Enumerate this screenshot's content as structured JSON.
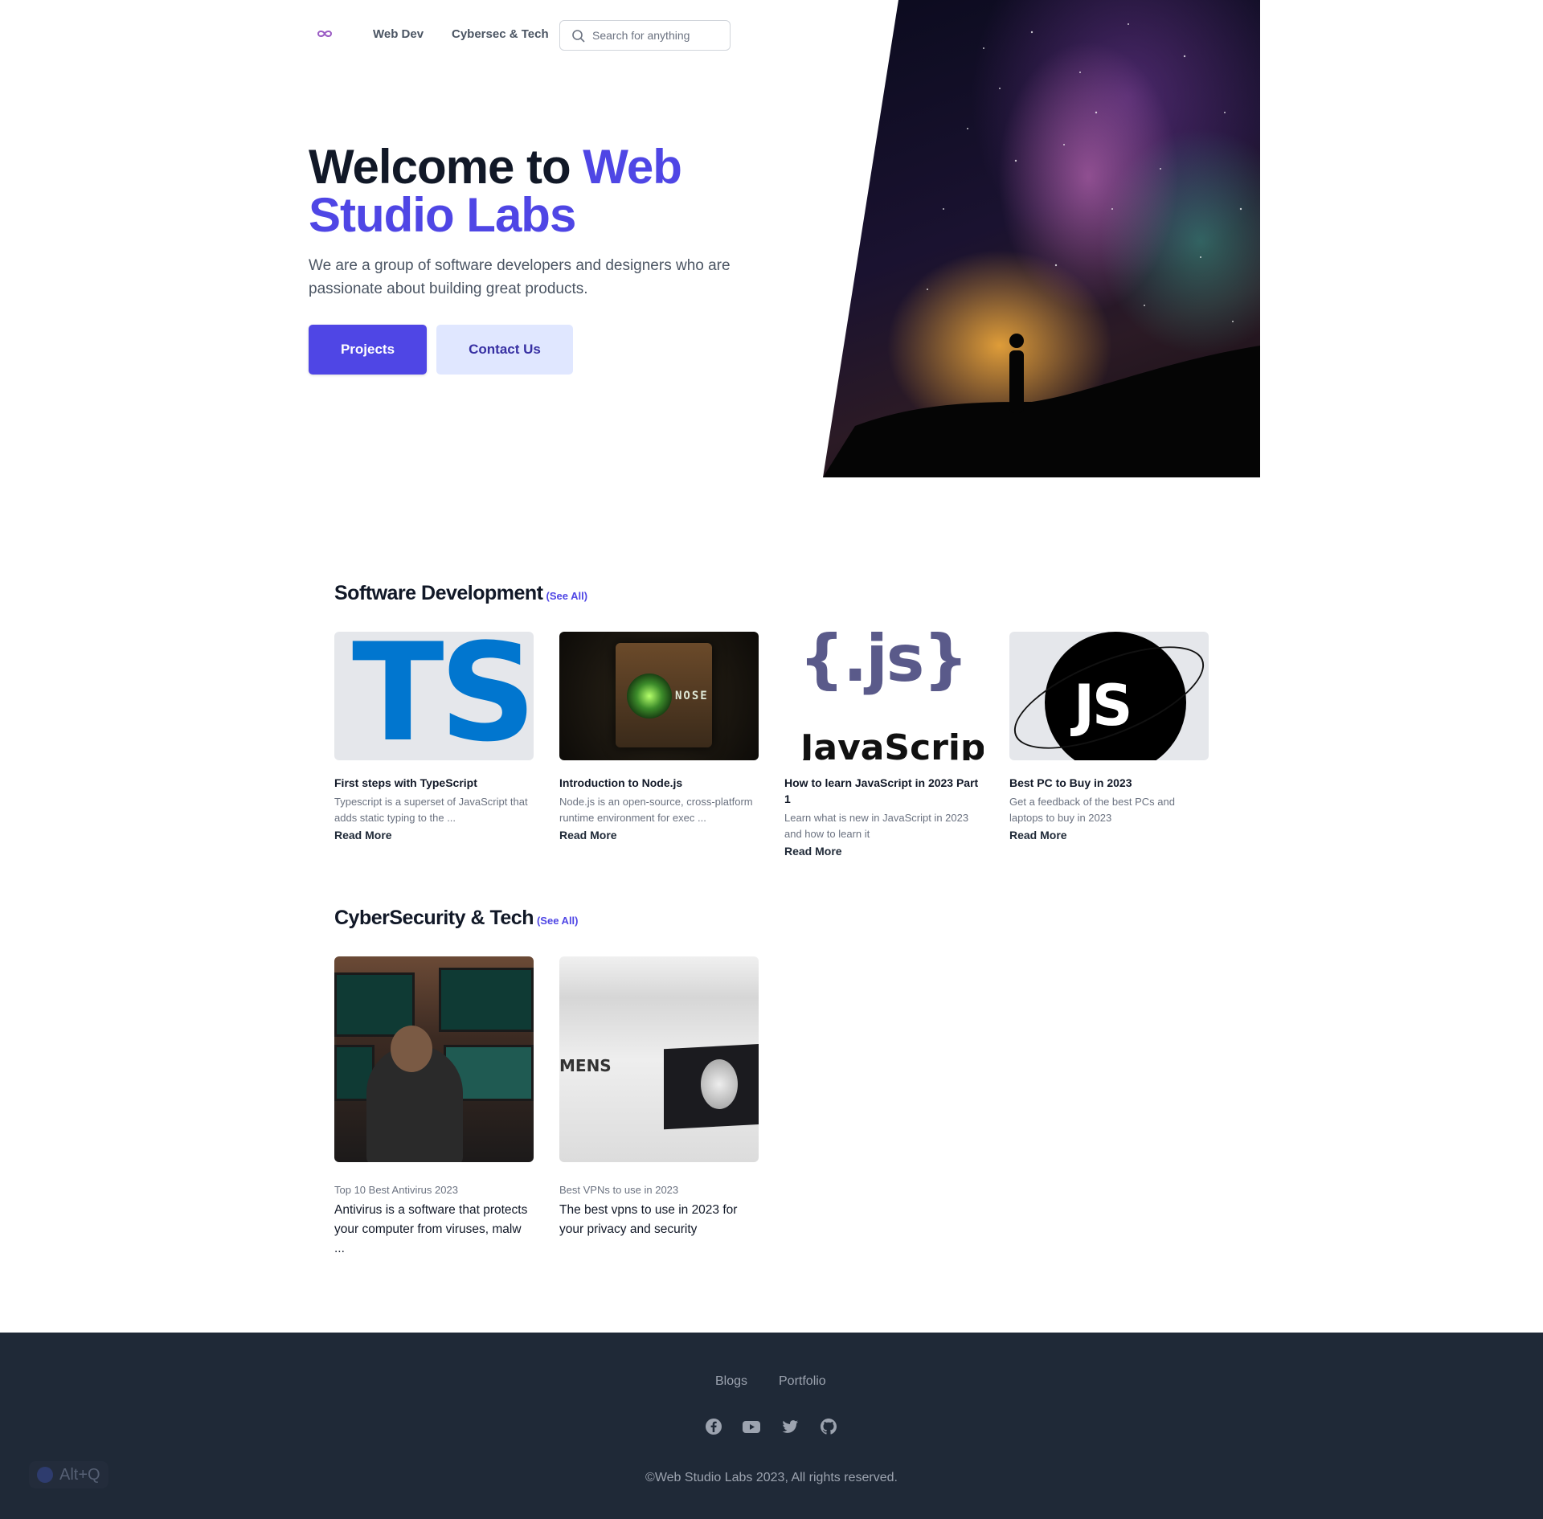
{
  "header": {
    "nav": [
      "Web Dev",
      "Cybersec & Tech"
    ],
    "search_placeholder": "Search for anything"
  },
  "hero": {
    "title_plain": "Welcome to ",
    "title_accent": "Web Studio Labs",
    "subtitle": "We are a group of software developers and designers who are passionate about building great products.",
    "primary_button": "Projects",
    "secondary_button": "Contact Us"
  },
  "sections": {
    "software": {
      "title": "Software Development",
      "see_all": "(See All)",
      "cards": [
        {
          "image_text": "TS",
          "title": "First steps with TypeScript",
          "description": "Typescript is a superset of JavaScript that adds static typing to the ...",
          "read_more": "Read More"
        },
        {
          "image_text": "NOSE",
          "title": "Introduction to Node.js",
          "description": "Node.js is an open-source, cross-platform runtime environment for exec ...",
          "read_more": "Read More"
        },
        {
          "image_text_1": "{.js}",
          "image_text_2": "JavaScript",
          "title": "How to learn JavaScript in 2023 Part 1",
          "description": "Learn what is new in JavaScript in 2023 and how to learn it",
          "read_more": "Read More"
        },
        {
          "image_text": "JS",
          "title": "Best PC to Buy in 2023",
          "description": "Get a feedback of the best PCs and laptops to buy in 2023",
          "read_more": "Read More"
        }
      ]
    },
    "cyber": {
      "title": "CyberSecurity & Tech",
      "see_all": "(See All)",
      "cards": [
        {
          "caption": "Top 10 Best Antivirus 2023",
          "body": "Antivirus is a software that protects your computer from viruses, malw ..."
        },
        {
          "image_text": "MENS",
          "caption": "Best VPNs to use in 2023",
          "body": "The best vpns to use in 2023 for your privacy and security"
        }
      ]
    }
  },
  "footer": {
    "links": [
      "Blogs",
      "Portfolio"
    ],
    "social_icons": [
      "facebook-icon",
      "youtube-icon",
      "twitter-icon",
      "github-icon"
    ],
    "copyright": "©Web Studio Labs 2023, All rights reserved."
  },
  "overlay": {
    "hotkey": "Alt+Q"
  },
  "colors": {
    "accent": "#4f46e5",
    "accent_light": "#e0e7ff",
    "footer_bg": "#1f2937",
    "text_dark": "#111827",
    "text_muted": "#6b7280"
  }
}
